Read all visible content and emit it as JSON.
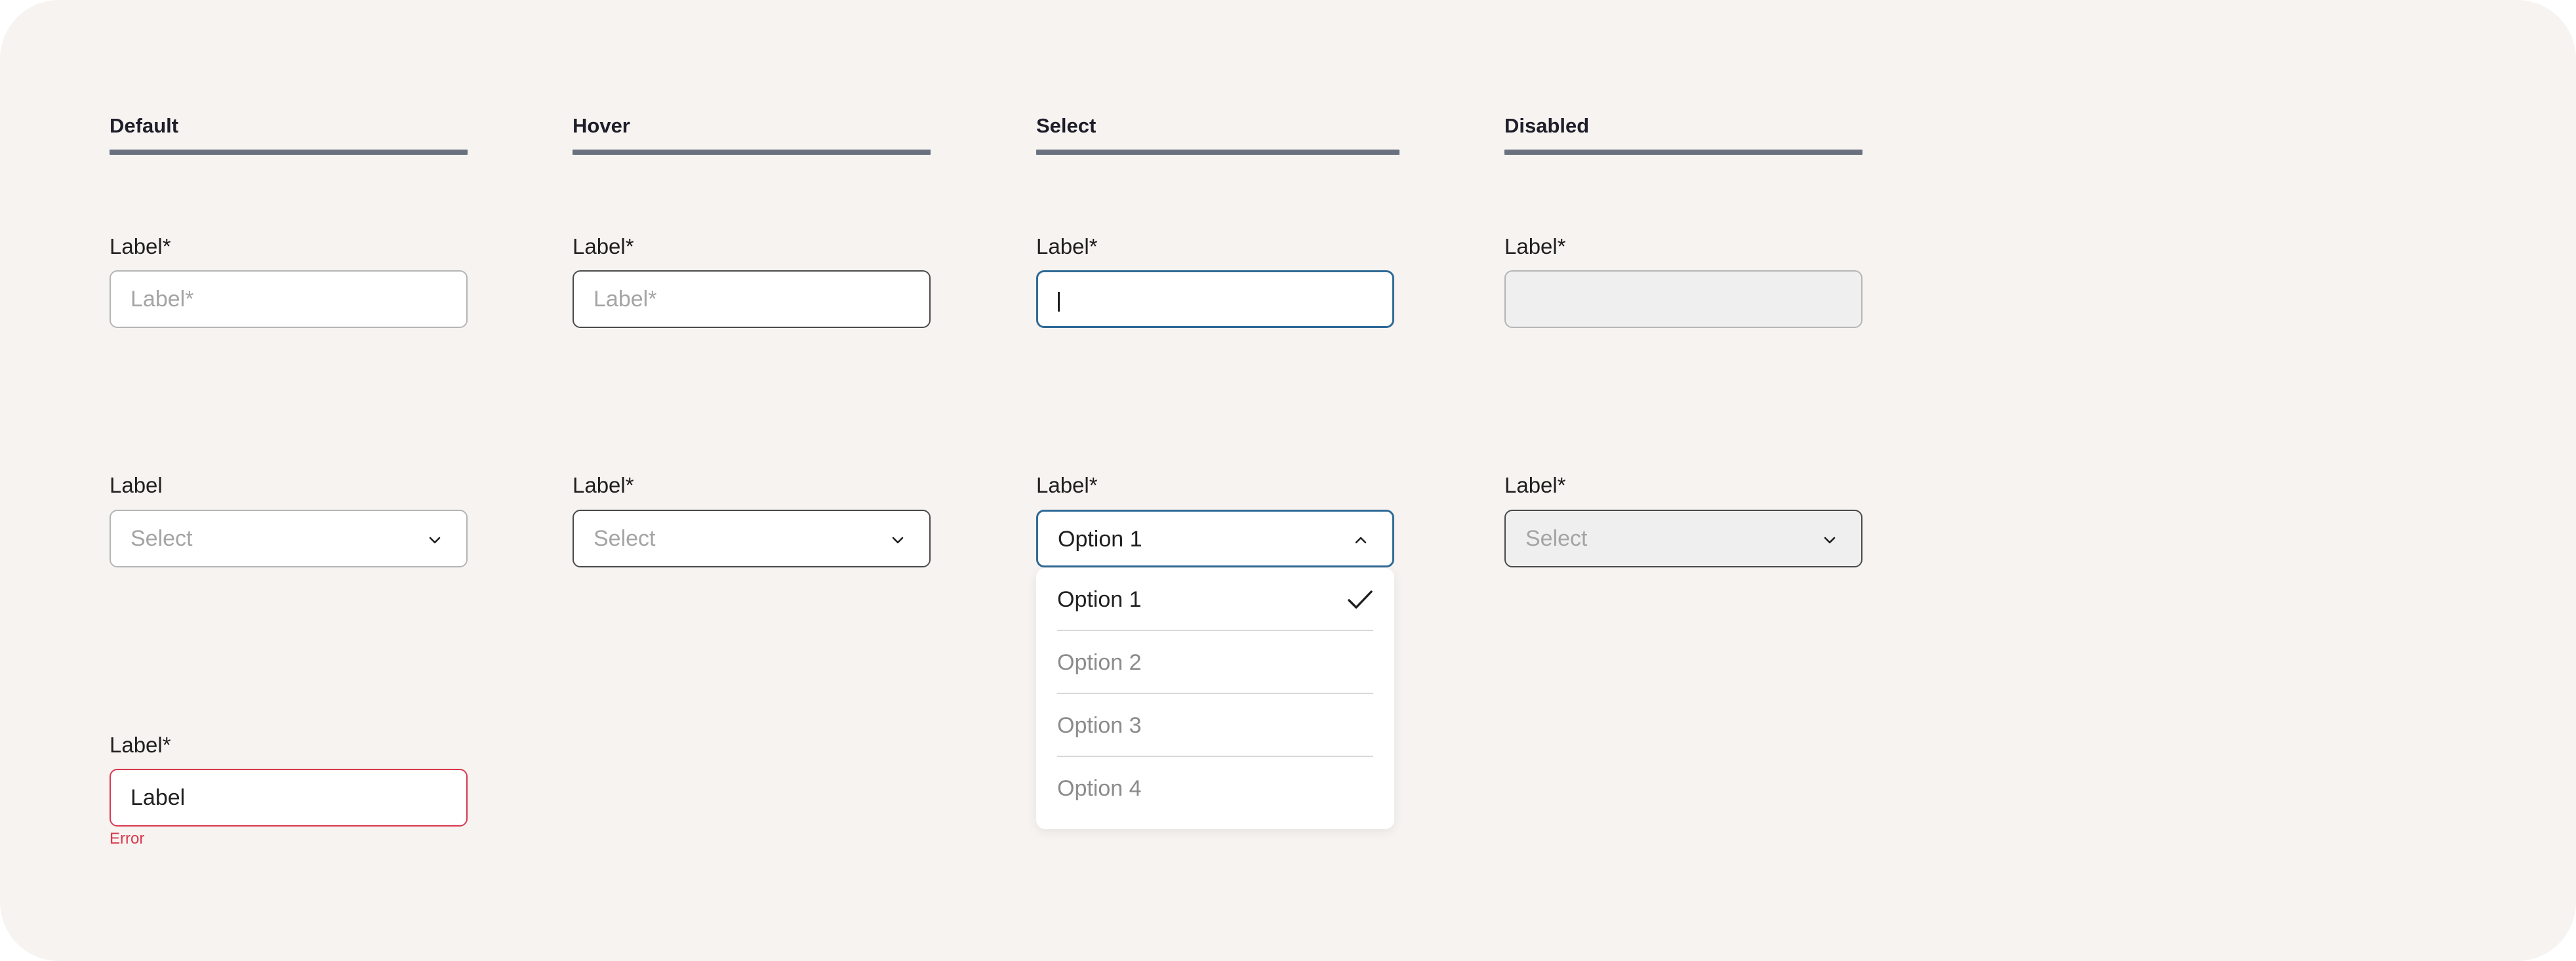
{
  "columns": [
    {
      "title": "Default"
    },
    {
      "title": "Hover"
    },
    {
      "title": "Select"
    },
    {
      "title": "Disabled"
    }
  ],
  "text_fields": {
    "label": "Label*",
    "default": {
      "placeholder": "Label*"
    },
    "hover": {
      "placeholder": "Label*"
    },
    "select": {
      "value": ""
    },
    "disabled": {
      "value": ""
    }
  },
  "select_fields": {
    "default": {
      "label": "Label",
      "placeholder": "Select"
    },
    "hover": {
      "label": "Label*",
      "placeholder": "Select"
    },
    "open": {
      "label": "Label*",
      "value": "Option 1"
    },
    "disabled": {
      "label": "Label*",
      "placeholder": "Select"
    }
  },
  "dropdown": {
    "options": [
      "Option 1",
      "Option 2",
      "Option 3",
      "Option 4"
    ],
    "selected": "Option 1"
  },
  "error_field": {
    "label": "Label*",
    "value": "Label",
    "error": "Error"
  },
  "icons": {
    "chevron_down": "chevron-down-icon",
    "chevron_up": "chevron-up-icon",
    "check": "check-icon"
  },
  "colors": {
    "background": "#f6f3f0",
    "rule": "#69717f",
    "focus_border": "#2e6a97",
    "error": "#d9384f",
    "disabled_fill": "#efefef"
  }
}
